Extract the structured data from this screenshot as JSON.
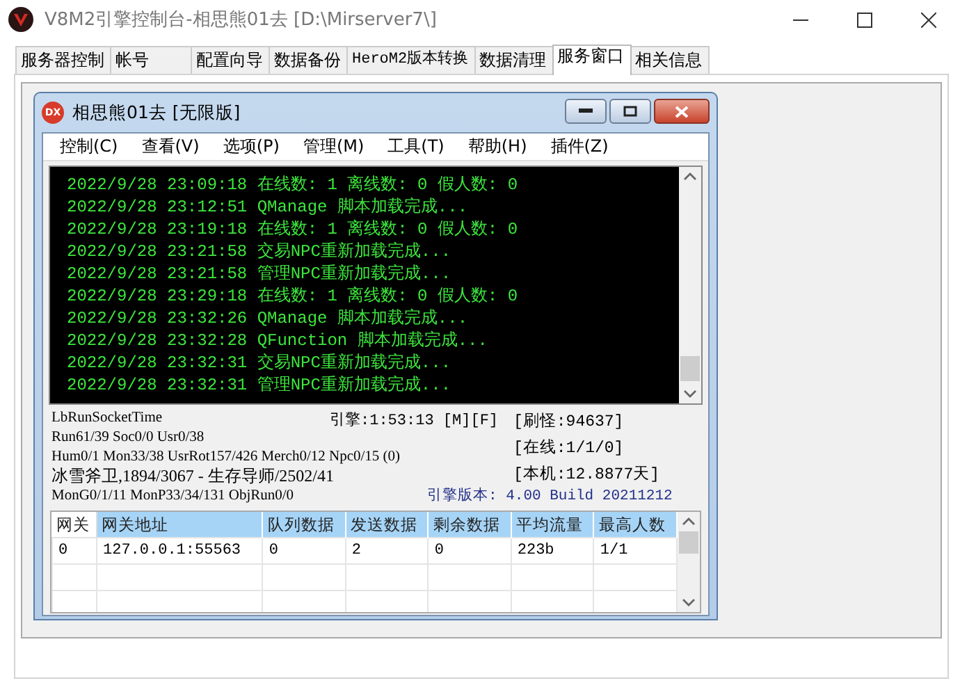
{
  "window": {
    "title": "V8M2引擎控制台-相思熊01去 [D:\\Mirserver7\\]"
  },
  "tabs": [
    {
      "label": "服务器控制",
      "selected": false
    },
    {
      "label": "帐号",
      "selected": false
    },
    {
      "label": "配置向导",
      "selected": false
    },
    {
      "label": "数据备份",
      "selected": false
    },
    {
      "label": "HeroM2版本转换",
      "selected": false
    },
    {
      "label": "数据清理",
      "selected": false
    },
    {
      "label": "服务窗口",
      "selected": true
    },
    {
      "label": "相关信息",
      "selected": false
    }
  ],
  "child_window": {
    "badge": "DX",
    "title": "相思熊01去 [无限版]",
    "menu": [
      "控制(C)",
      "查看(V)",
      "选项(P)",
      "管理(M)",
      "工具(T)",
      "帮助(H)",
      "插件(Z)"
    ],
    "console_lines": [
      "2022/9/28 23:09:18 在线数: 1 离线数: 0 假人数: 0",
      "2022/9/28 23:12:51 QManage 脚本加载完成...",
      "2022/9/28 23:19:18 在线数: 1 离线数: 0 假人数: 0",
      "2022/9/28 23:21:58 交易NPC重新加载完成...",
      "2022/9/28 23:21:58 管理NPC重新加载完成...",
      "2022/9/28 23:29:18 在线数: 1 离线数: 0 假人数: 0",
      "2022/9/28 23:32:26 QManage 脚本加载完成...",
      "2022/9/28 23:32:28 QFunction 脚本加载完成...",
      "2022/9/28 23:32:31 交易NPC重新加载完成...",
      "2022/9/28 23:32:31 管理NPC重新加载完成..."
    ],
    "status": {
      "lines": [
        "LbRunSocketTime",
        "Run61/39 Soc0/0 Usr0/38",
        "Hum0/1 Mon33/38 UsrRot157/426 Merch0/12 Npc0/15 (0)",
        "冰雪斧卫,1894/3067 - 生存导师/2502/41",
        "MonG0/1/11 MonP33/34/131 ObjRun0/0"
      ],
      "engine_time": "引擎:1:53:13 [M][F]",
      "info": [
        "[刷怪:94637]",
        "[在线:1/1/0]",
        "[本机:12.8877天]"
      ],
      "version": "引擎版本: 4.00 Build 20211212"
    },
    "table": {
      "columns": [
        "网关",
        "网关地址",
        "队列数据",
        "发送数据",
        "剩余数据",
        "平均流量",
        "最高人数"
      ],
      "rows": [
        [
          "0",
          "127.0.0.1:55563",
          "0",
          "2",
          "0",
          "223b",
          "1/1"
        ]
      ]
    }
  }
}
